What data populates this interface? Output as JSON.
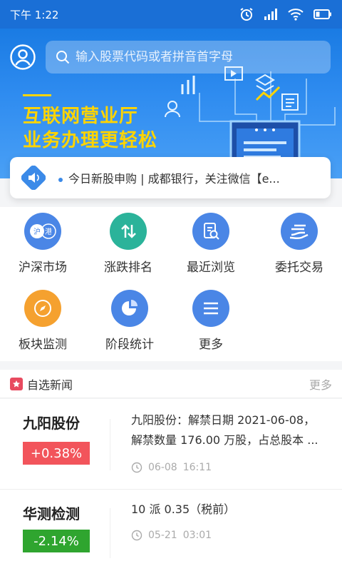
{
  "status_bar": {
    "time": "下午 1:22"
  },
  "search": {
    "placeholder": "输入股票代码或者拼音首字母"
  },
  "banner": {
    "line1": "互联网营业厅",
    "line2": "业务办理更轻松"
  },
  "notice": {
    "text": "今日新股申购 | 成都银行，关注微信【e..."
  },
  "grid": {
    "items": [
      {
        "label": "沪深市场",
        "icon": "shanghai-shenzhen-market-icon",
        "color": "#4a86e6"
      },
      {
        "label": "涨跌排名",
        "icon": "up-down-arrows-icon",
        "color": "#2bb39a"
      },
      {
        "label": "最近浏览",
        "icon": "document-search-icon",
        "color": "#4a86e6"
      },
      {
        "label": "委托交易",
        "icon": "hand-coins-icon",
        "color": "#4a86e6"
      },
      {
        "label": "板块监测",
        "icon": "compass-icon",
        "color": "#f5a12f"
      },
      {
        "label": "阶段统计",
        "icon": "pie-chart-icon",
        "color": "#4a86e6"
      },
      {
        "label": "更多",
        "icon": "menu-icon",
        "color": "#4a86e6"
      }
    ]
  },
  "news": {
    "title": "自选新闻",
    "more": "更多",
    "items": [
      {
        "stock": "九阳股份",
        "change": "+0.38%",
        "change_color": "#f2545b",
        "line1": "九阳股份：解禁日期 2021-06-08，",
        "line2": "解禁数量 176.00 万股，占总股本 ...",
        "date": "06-08",
        "time": "16:11"
      },
      {
        "stock": "华测检测",
        "change": "-2.14%",
        "change_color": "#2fa52f",
        "line1": "10 派 0.35（税前）",
        "date": "05-21",
        "time": "03:01"
      }
    ]
  }
}
